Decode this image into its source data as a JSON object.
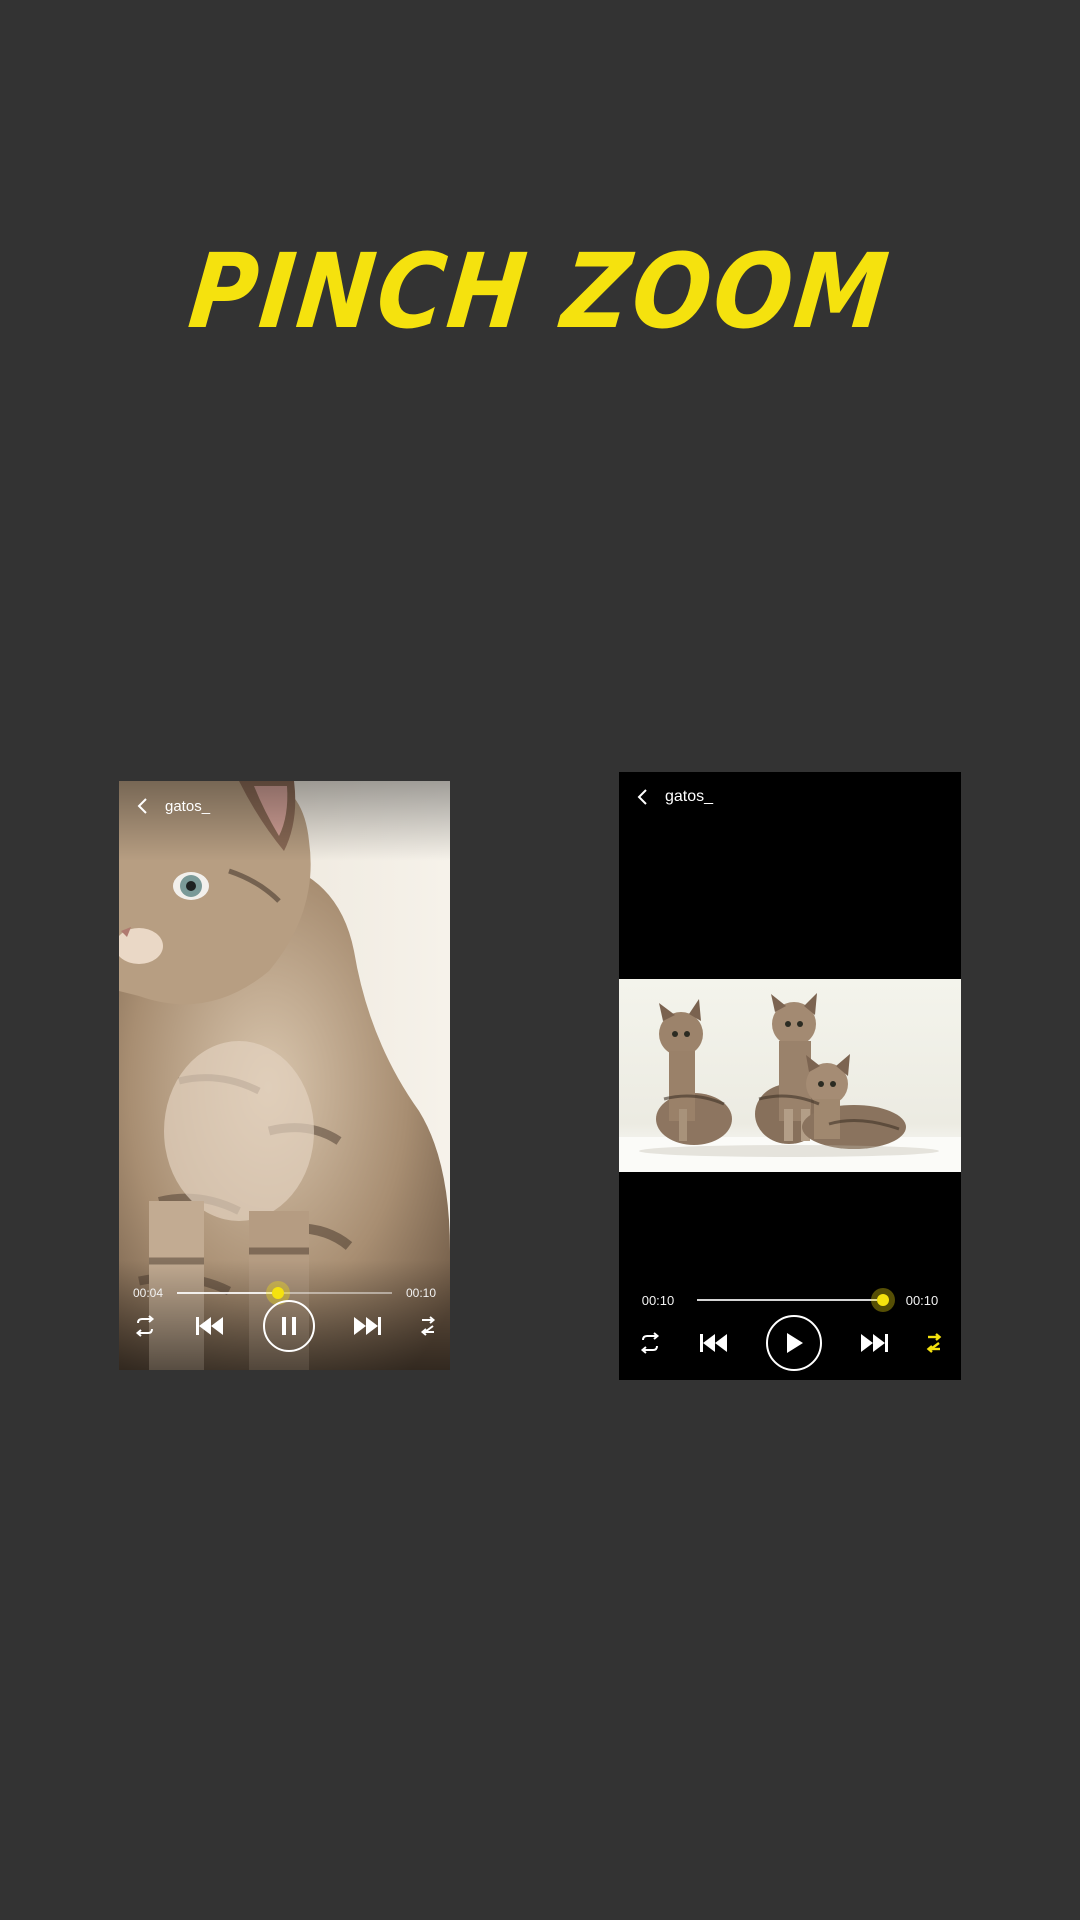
{
  "headline": "PINCH ZOOM",
  "colors": {
    "background": "#333333",
    "accent": "#f5e20e",
    "player_background": "#000000"
  },
  "left_player": {
    "title": "gatos_",
    "current_time": "00:04",
    "total_time": "00:10",
    "progress": 0.47,
    "state": "playing",
    "icons": [
      "chevron-left-icon",
      "repeat-icon",
      "skip-previous-icon",
      "pause-icon",
      "skip-next-icon",
      "shuffle-icon"
    ]
  },
  "right_player": {
    "title": "gatos_",
    "current_time": "00:10",
    "total_time": "00:10",
    "progress": 1.0,
    "state": "paused",
    "icons": [
      "chevron-left-icon",
      "repeat-icon",
      "skip-previous-icon",
      "play-icon",
      "skip-next-icon",
      "shuffle-icon"
    ]
  }
}
